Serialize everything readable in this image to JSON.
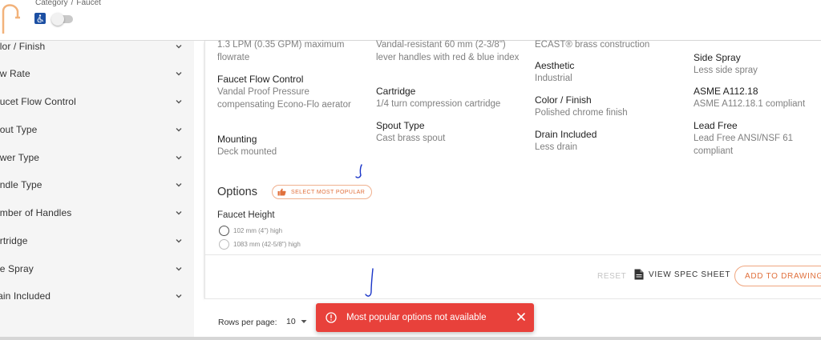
{
  "header": {
    "breadcrumb": [
      "Category",
      "Faucet"
    ],
    "breadcrumb_sep": "/"
  },
  "sidebar": {
    "filters": [
      {
        "label": "olor / Finish"
      },
      {
        "label": "ow Rate"
      },
      {
        "label": "aucet Flow Control"
      },
      {
        "label": "pout Type"
      },
      {
        "label": "ower Type"
      },
      {
        "label": "andle Type"
      },
      {
        "label": "umber of Handles"
      },
      {
        "label": "artridge"
      },
      {
        "label": "de Spray"
      },
      {
        "label": "rain Included"
      }
    ]
  },
  "specs": {
    "col1": {
      "top_value": "1.3 LPM (0.35 GPM) maximum flowrate",
      "items": [
        {
          "key": "Faucet Flow Control",
          "value": "Vandal Proof Pressure compensating Econo-Flo aerator"
        },
        {
          "key": "Mounting",
          "value": "Deck mounted"
        }
      ]
    },
    "col2": {
      "top_value": "Vandal-resistant 60 mm (2-3/8\") lever handles with red & blue index",
      "items": [
        {
          "key": "Cartridge",
          "value": "1/4 turn compression cartridge"
        },
        {
          "key": "Spout Type",
          "value": "Cast brass spout"
        }
      ]
    },
    "col3": {
      "top_value": "ECAST® brass construction",
      "items": [
        {
          "key": "Aesthetic",
          "value": "Industrial"
        },
        {
          "key": "Color / Finish",
          "value": "Polished chrome finish"
        },
        {
          "key": "Drain Included",
          "value": "Less drain"
        }
      ]
    },
    "col4": {
      "items": [
        {
          "key": "Side Spray",
          "value": "Less side spray"
        },
        {
          "key": "ASME A112.18",
          "value": "ASME A112.18.1 compliant"
        },
        {
          "key": "Lead Free",
          "value": "Lead Free ANSI/NSF 61 compliant"
        }
      ]
    }
  },
  "options": {
    "title": "Options",
    "popular_button": "SELECT MOST POPULAR",
    "faucet_height": {
      "title": "Faucet Height",
      "choices": [
        "102 mm (4\") high",
        "1083 mm (42-5/8\") high"
      ]
    }
  },
  "actions": {
    "reset": "RESET",
    "view_spec_sheet": "VIEW SPEC SHEET",
    "add_to_drawing": "ADD TO DRAWING"
  },
  "pagination": {
    "rows_label": "Rows per page:",
    "rows_value": "10"
  },
  "toast": {
    "message": "Most popular options not available",
    "color": "#e8413b"
  },
  "colors": {
    "accent": "#e0703c",
    "annotation": "#1a35c8"
  }
}
